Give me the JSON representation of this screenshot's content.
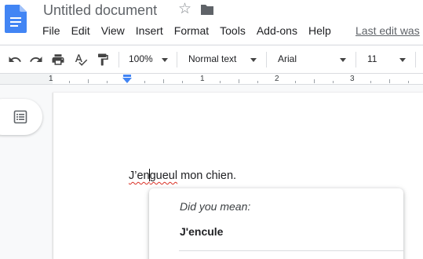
{
  "header": {
    "title": "Untitled document",
    "menu": [
      "File",
      "Edit",
      "View",
      "Insert",
      "Format",
      "Tools",
      "Add-ons",
      "Help"
    ],
    "last_edit": "Last edit was"
  },
  "toolbar": {
    "zoom": "100%",
    "style": "Normal text",
    "font": "Arial",
    "font_size": "11"
  },
  "ruler": {
    "labels": [
      "1",
      "1",
      "2",
      "3"
    ]
  },
  "document": {
    "word_before_cursor": "J’en",
    "word_after_cursor": "gueul",
    "rest_of_text": " mon chien."
  },
  "suggestion_popup": {
    "heading": "Did you mean:",
    "suggestion": "J'encule"
  },
  "colors": {
    "docs_blue": "#4285f4",
    "misspelling_red": "#d93025"
  }
}
